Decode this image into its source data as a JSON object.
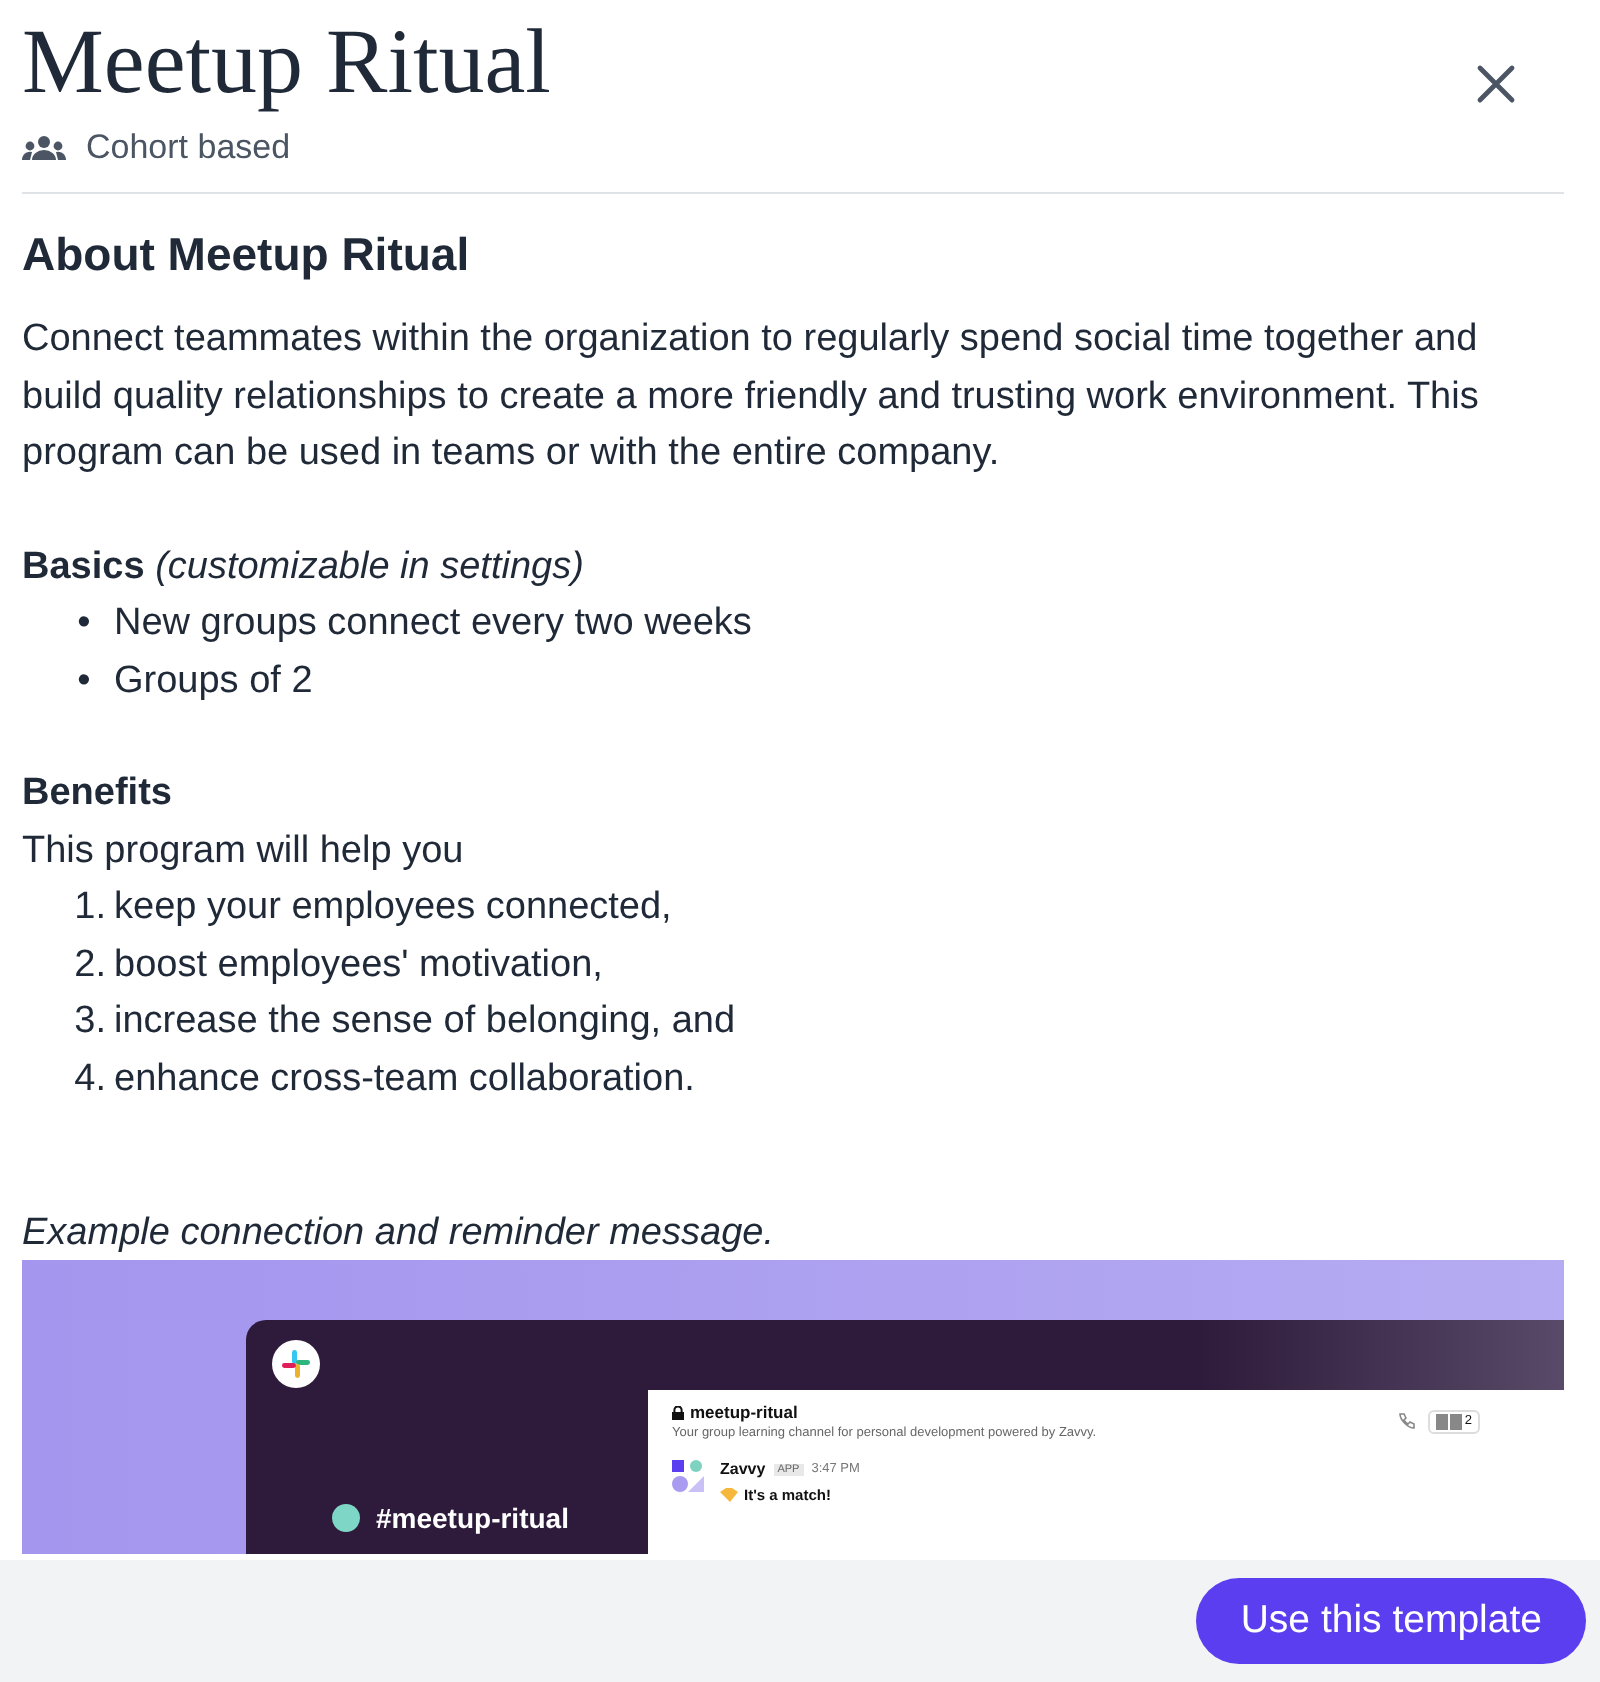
{
  "header": {
    "title": "Meetup Ritual",
    "subtitle": "Cohort based"
  },
  "about": {
    "heading": "About Meetup Ritual",
    "description": "Connect teammates within the organization to regularly spend social time together and build quality relationships to create a more friendly and trusting work environment. This program can be used in teams or with the entire company."
  },
  "basics": {
    "heading": "Basics",
    "note": "(customizable in settings)",
    "items": [
      {
        "marker": "•",
        "text": "New groups connect every two weeks"
      },
      {
        "marker": "•",
        "text": "Groups of 2"
      }
    ]
  },
  "benefits": {
    "heading": "Benefits",
    "intro": "This program will help you",
    "items": [
      {
        "marker": "1.",
        "text": "keep your employees connected,"
      },
      {
        "marker": "2.",
        "text": "boost employees' motivation,"
      },
      {
        "marker": "3.",
        "text": "increase the sense of belonging, and"
      },
      {
        "marker": "4.",
        "text": "enhance cross-team collaboration."
      }
    ]
  },
  "example": {
    "caption": "Example connection and reminder message.",
    "preview": {
      "sidebar_channel": "#meetup-ritual",
      "channel_name": "meetup-ritual",
      "channel_description": "Your group learning channel for personal development powered by Zavvy.",
      "member_count": "2",
      "message": {
        "sender": "Zavvy",
        "badge": "APP",
        "time": "3:47 PM",
        "text": "It's a match!"
      }
    }
  },
  "footer": {
    "button": "Use this template"
  }
}
